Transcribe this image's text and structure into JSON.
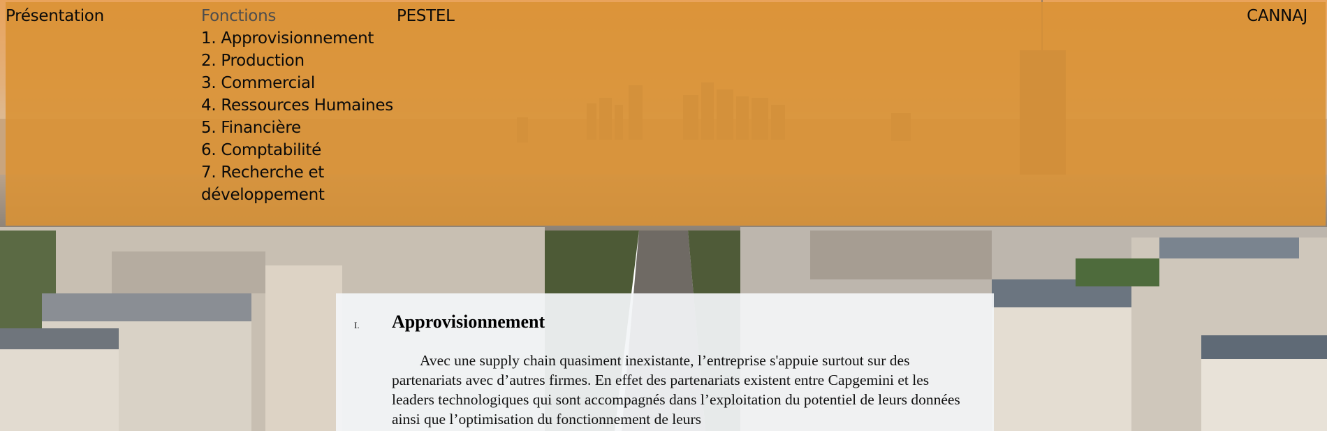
{
  "nav": {
    "presentation": "Présentation",
    "fonctions": "Fonctions",
    "pestel": "PESTEL",
    "cannaj": "CANNAJ",
    "submenu": [
      "1. Approvisionnement",
      "2. Production",
      "3. Commercial",
      "4. Ressources Humaines",
      "5. Financière",
      "6. Comptabilité",
      "7. Recherche et développement"
    ]
  },
  "section": {
    "number": "I.",
    "title": "Approvisionnement",
    "body": "Avec une supply chain quasiment inexistante, l’entreprise s'appuie surtout sur des partenariats avec d’autres firmes. En effet des partenariats existent entre Capgemini et les leaders technologiques qui sont accompagnés dans l’exploitation du potentiel de leurs données ainsi que l’optimisation du fonctionnement de leurs"
  },
  "colors": {
    "header_overlay": "#d99234",
    "card_background": "#f3f5f7",
    "nav_active": "#4d4d4d",
    "nav_text": "#0a0a0a"
  }
}
